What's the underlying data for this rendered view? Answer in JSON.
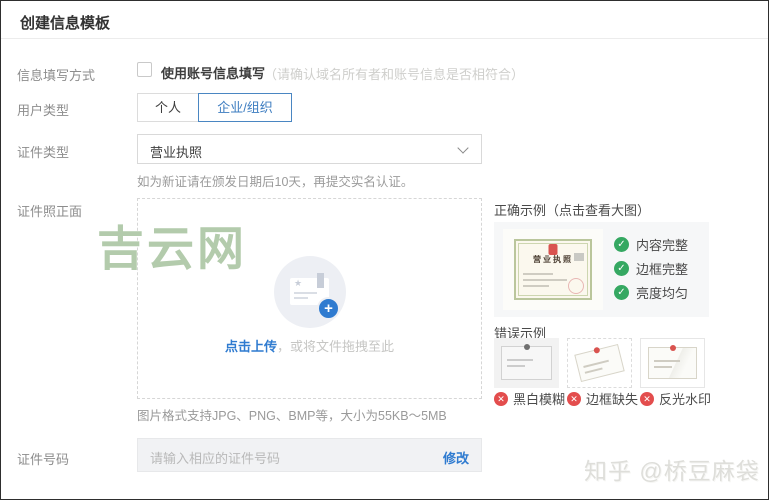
{
  "header": {
    "title": "创建信息模板"
  },
  "form": {
    "fill_mode": {
      "label": "信息填写方式",
      "checkbox_label": "使用账号信息填写",
      "note": "（请确认域名所有者和账号信息是否相符合）"
    },
    "user_type": {
      "label": "用户类型",
      "options": [
        {
          "label": "个人",
          "selected": false
        },
        {
          "label": "企业/组织",
          "selected": true
        }
      ]
    },
    "cert_type": {
      "label": "证件类型",
      "value": "营业执照",
      "helper": "如为新证请在颁发日期后10天，再提交实名认证。"
    },
    "cert_photo": {
      "label": "证件照正面",
      "upload_link": "点击上传",
      "upload_hint": "，或将文件拖拽至此",
      "format_hint": "图片格式支持JPG、PNG、BMP等，大小为55KB～5MB"
    },
    "cert_number": {
      "label": "证件号码",
      "placeholder": "请输入相应的证件号码",
      "modify_link": "修改"
    }
  },
  "examples": {
    "correct": {
      "title": "正确示例（点击查看大图）",
      "sample_title": "营业执照",
      "checks": [
        "内容完整",
        "边框完整",
        "亮度均匀"
      ]
    },
    "wrong": {
      "title": "错误示例",
      "items": [
        "黑白模糊",
        "边框缺失",
        "反光水印"
      ]
    }
  },
  "watermarks": {
    "center": "吉云网",
    "bottom_right": "知乎 @桥豆麻袋"
  },
  "colors": {
    "accent": "#2f7bd0",
    "selected_border": "#4a86c2",
    "check_green": "#35a862",
    "error_red": "#e34d4d",
    "watermark_green": "#b3cbac"
  }
}
